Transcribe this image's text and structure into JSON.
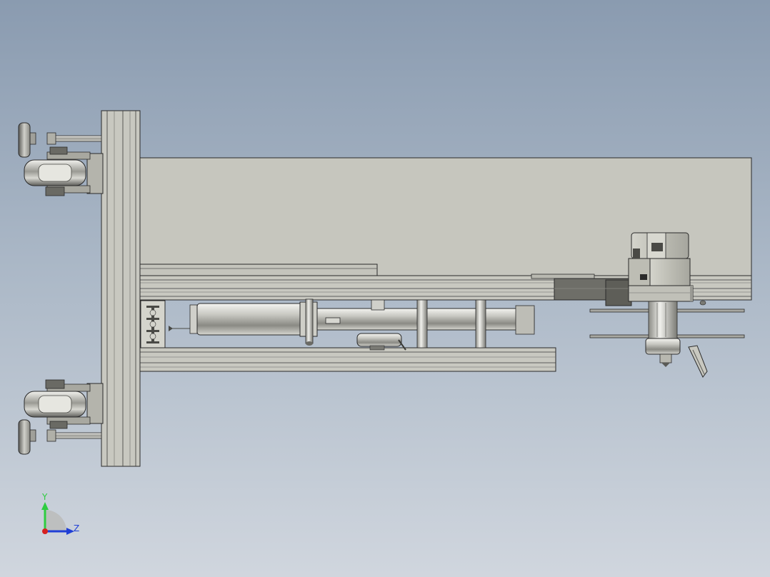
{
  "viewport": {
    "background_top": "#8a9bb0",
    "background_bottom": "#d0d6de"
  },
  "model": {
    "part_fill": "#c4c4bc",
    "part_stroke": "#2a2a2a",
    "metal_light": "#e8e8e4",
    "metal_dark": "#6e6e6a"
  },
  "triad": {
    "y_label": "Y",
    "z_label": "Z",
    "y_color": "#2ecc40",
    "z_color": "#1f3fd6",
    "x_color": "#d62020"
  }
}
